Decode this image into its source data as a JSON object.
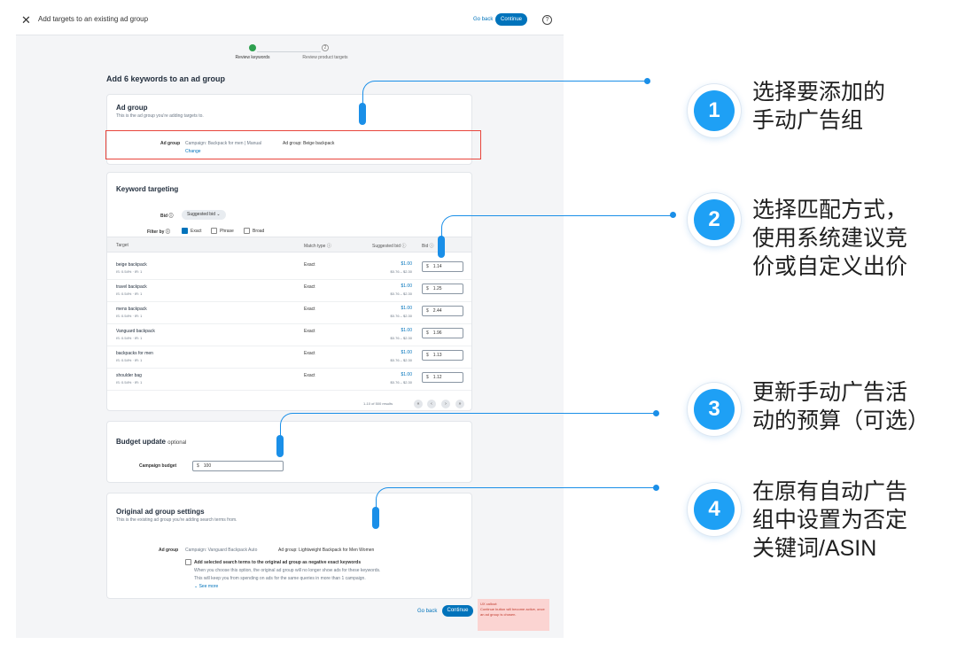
{
  "header": {
    "close_icon": "close-icon",
    "title": "Add targets to an existing ad group",
    "go_back": "Go back",
    "continue": "Continue",
    "help_icon": "help-icon"
  },
  "steps": [
    {
      "label": "Review keywords"
    },
    {
      "label": "Review product targets",
      "number": "2"
    }
  ],
  "page_title": "Add 6 keywords to an ad group",
  "ad_group_card": {
    "title": "Ad group",
    "subtitle": "This is the ad group you're adding targets to.",
    "field_label": "Ad group",
    "campaign": "Campaign: Backpack for men | Manual",
    "ad_group": "Ad group: Beige backpack",
    "change_link": "Change"
  },
  "keyword_card": {
    "title": "Keyword targeting",
    "bid_label": "Bid ⓘ",
    "bid_option": "Suggested bid ⌄",
    "filter_label": "Filter by ⓘ",
    "filters": [
      {
        "label": "Exact",
        "checked": true
      },
      {
        "label": "Phrase",
        "checked": false
      },
      {
        "label": "Broad",
        "checked": false
      }
    ],
    "columns": {
      "target": "Target",
      "match_type": "Match type ⓘ",
      "suggested_bid": "Suggested bid ⓘ",
      "bid": "Bid ⓘ"
    },
    "rows": [
      {
        "keyword": "beige backpack",
        "meta": "IS: 0.54% · IR: 1",
        "match": "Exact",
        "suggested": "$1.00",
        "range": "$0.76 – $2.30",
        "bid": "1.14"
      },
      {
        "keyword": "travel backpack",
        "meta": "IS: 0.54% · IR: 1",
        "match": "Exact",
        "suggested": "$1.00",
        "range": "$0.76 – $2.30",
        "bid": "1.25"
      },
      {
        "keyword": "mens backpack",
        "meta": "IS: 0.54% · IR: 1",
        "match": "Exact",
        "suggested": "$1.00",
        "range": "$0.76 – $2.30",
        "bid": "2.44"
      },
      {
        "keyword": "Vanguard backpack",
        "meta": "IS: 0.54% · IR: 1",
        "match": "Exact",
        "suggested": "$1.00",
        "range": "$0.76 – $2.30",
        "bid": "1.96"
      },
      {
        "keyword": "backpacks for men",
        "meta": "IS: 0.54% · IR: 1",
        "match": "Exact",
        "suggested": "$1.00",
        "range": "$0.76 – $2.30",
        "bid": "1.13"
      },
      {
        "keyword": "shoulder bag",
        "meta": "IS: 0.54% · IR: 1",
        "match": "Exact",
        "suggested": "$1.00",
        "range": "$0.76 – $2.30",
        "bid": "1.12"
      }
    ],
    "currency": "$",
    "pagination": "1-10 of 500 results",
    "pager_icons": [
      "first-page-icon",
      "prev-page-icon",
      "next-page-icon",
      "last-page-icon"
    ]
  },
  "budget_card": {
    "title": "Budget update",
    "optional": "optional",
    "field_label": "Campaign budget",
    "currency": "$",
    "value": "100"
  },
  "original_card": {
    "title": "Original ad group settings",
    "subtitle": "This is the existing ad group you're adding search terms from.",
    "field_label": "Ad group",
    "campaign": "Campaign: Vanguard Backpack Auto",
    "ad_group": "Ad group: Lightweight Backpack for Men Women",
    "checkbox_label": "Add selected search terms to the original ad group as negative exact keywords",
    "desc1": "When you choose this option, the original ad group will no longer show ads for these keywords.",
    "desc2": "This will keep you from spending on ads for the same queries in more than 1 campaign.",
    "see_more": "⌄ See more"
  },
  "footer": {
    "go_back": "Go back",
    "continue": "Continue",
    "callout_title": "UX callout:",
    "callout_text": "Continue button will become active, once an ad group is chosen."
  },
  "annotations": [
    {
      "number": "1",
      "lines": [
        "选择要添加的",
        "手动广告组"
      ]
    },
    {
      "number": "2",
      "lines": [
        "选择匹配方式，",
        "使用系统建议竞",
        "价或自定义出价"
      ]
    },
    {
      "number": "3",
      "lines": [
        "更新手动广告活",
        "动的预算（可选）"
      ]
    },
    {
      "number": "4",
      "lines": [
        "在原有自动广告",
        "组中设置为否定",
        "关键词/ASIN"
      ]
    }
  ],
  "colors": {
    "accent": "#0073bb",
    "annotation_blue": "#1ea0f5",
    "highlight_red": "#e8453c",
    "success_green": "#2ea04f"
  }
}
